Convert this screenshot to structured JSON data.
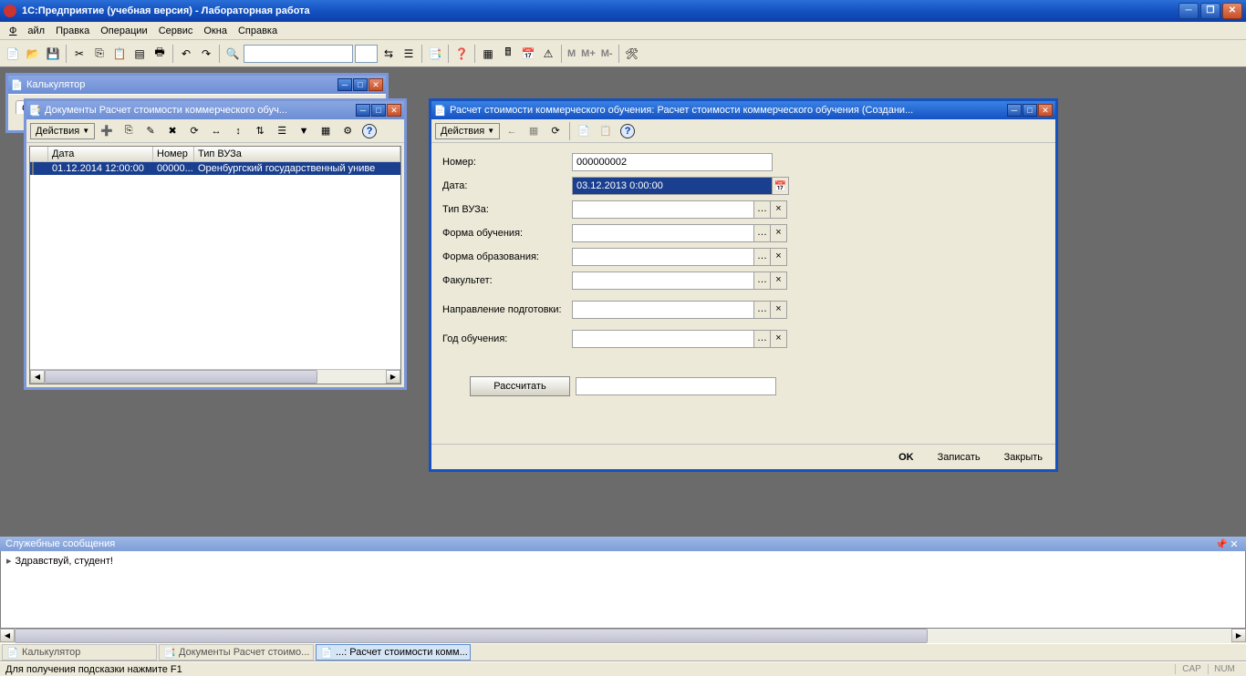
{
  "app": {
    "title": "1С:Предприятие (учебная версия) - Лабораторная работа"
  },
  "menu": {
    "file": "Файл",
    "edit": "Правка",
    "operations": "Операции",
    "service": "Сервис",
    "windows": "Окна",
    "help": "Справка"
  },
  "toolbar": {
    "m": "M",
    "mplus": "M+",
    "mminus": "M-"
  },
  "calc_bg": {
    "title": "Калькулятор",
    "tab": "Ст"
  },
  "list_win": {
    "title": "Документы Расчет стоимости коммерческого обуч...",
    "actions": "Действия",
    "columns": {
      "c1": "Дата",
      "c2": "Номер",
      "c3": "Тип ВУЗа"
    },
    "row": {
      "date": "01.12.2014 12:00:00",
      "num": "00000...",
      "type": "Оренбургский государственный униве"
    }
  },
  "form_win": {
    "title": "Расчет стоимости коммерческого обучения: Расчет стоимости коммерческого обучения (Создани...",
    "actions": "Действия",
    "labels": {
      "number": "Номер:",
      "date": "Дата:",
      "vuz": "Тип ВУЗа:",
      "form_study": "Форма обучения:",
      "form_edu": "Форма образования:",
      "faculty": "Факультет:",
      "direction": "Направление подготовки:",
      "year": "Год обучения:"
    },
    "values": {
      "number": "000000002",
      "date": "03.12.2013  0:00:00"
    },
    "calc_btn": "Рассчитать",
    "footer": {
      "ok": "OK",
      "save": "Записать",
      "close": "Закрыть"
    }
  },
  "messages": {
    "title": "Служебные сообщения",
    "text": "Здравствуй, студент!"
  },
  "taskbar": {
    "t1": "Калькулятор",
    "t2": "Документы Расчет стоимо...",
    "t3": "...: Расчет стоимости комм..."
  },
  "status": {
    "hint": "Для получения подсказки нажмите F1",
    "cap": "CAP",
    "num": "NUM"
  }
}
